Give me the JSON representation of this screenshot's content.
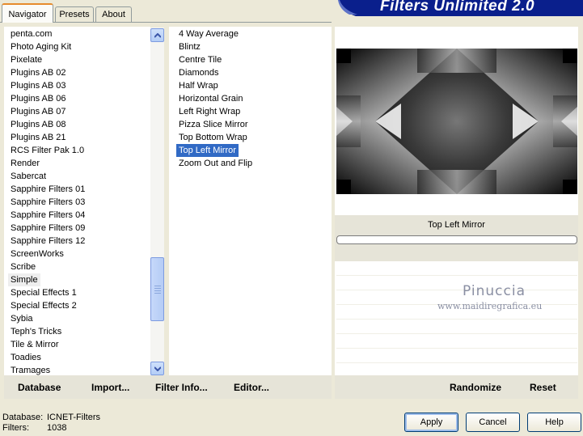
{
  "tabs": [
    {
      "label": "Navigator",
      "active": true
    },
    {
      "label": "Presets",
      "active": false
    },
    {
      "label": "About",
      "active": false
    }
  ],
  "banner_title": "Filters Unlimited 2.0",
  "categories": [
    "penta.com",
    "Photo Aging Kit",
    "Pixelate",
    "Plugins AB 02",
    "Plugins AB 03",
    "Plugins AB 06",
    "Plugins AB 07",
    "Plugins AB 08",
    "Plugins AB 21",
    "RCS Filter Pak 1.0",
    "Render",
    "Sabercat",
    "Sapphire Filters 01",
    "Sapphire Filters 03",
    "Sapphire Filters 04",
    "Sapphire Filters 09",
    "Sapphire Filters 12",
    "ScreenWorks",
    "Scribe",
    "Simple",
    "Special Effects 1",
    "Special Effects 2",
    "Sybia",
    "Teph's Tricks",
    "Tile & Mirror",
    "Toadies",
    "Tramages"
  ],
  "selected_category": "Simple",
  "filters": [
    "4 Way Average",
    "Blintz",
    "Centre Tile",
    "Diamonds",
    "Half Wrap",
    "Horizontal Grain",
    "Left Right Wrap",
    "Pizza Slice Mirror",
    "Top Bottom Wrap",
    "Top Left Mirror",
    "Zoom Out and Flip"
  ],
  "selected_filter": "Top Left Mirror",
  "filter_name_label": "Top Left Mirror",
  "watermark": {
    "name": "Pinuccia",
    "url": "www.maidiregrafica.eu"
  },
  "toolbar": {
    "database": "Database",
    "import": "Import...",
    "filter_info": "Filter Info...",
    "editor": "Editor...",
    "randomize": "Randomize",
    "reset": "Reset"
  },
  "status": {
    "database_label": "Database:",
    "database_value": "ICNET-Filters",
    "filters_label": "Filters:",
    "filters_value": "1038"
  },
  "buttons": {
    "apply": "Apply",
    "cancel": "Cancel",
    "help": "Help"
  },
  "colors": {
    "selection": "#316ac5",
    "banner": "#0a1f8c",
    "tab_highlight": "#e68b2c"
  }
}
